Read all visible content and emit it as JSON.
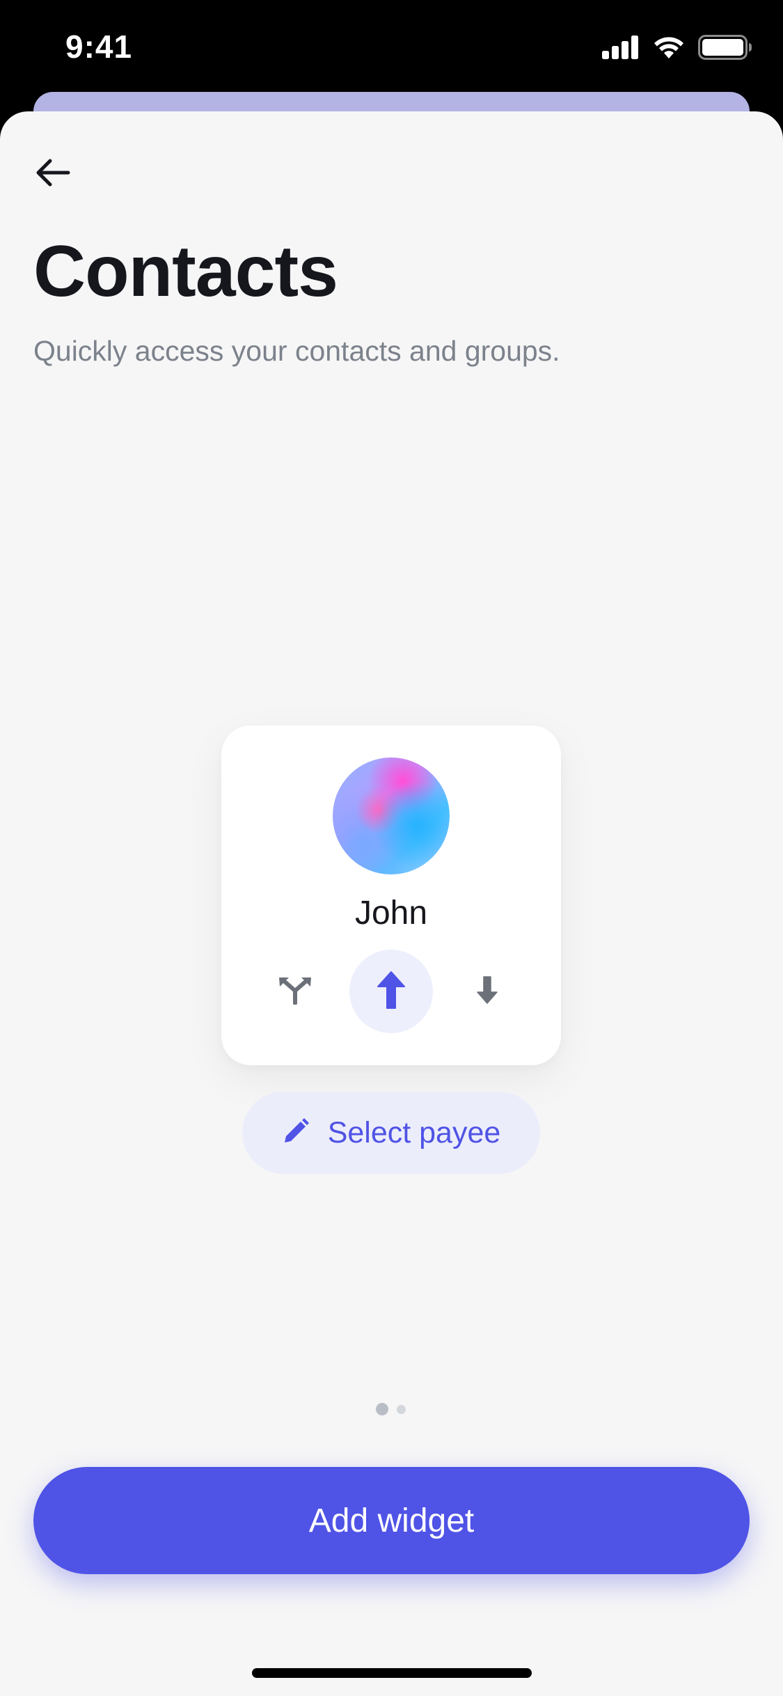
{
  "status_bar": {
    "time": "9:41",
    "icons": [
      "cellular-signal-icon",
      "wifi-icon",
      "battery-icon"
    ]
  },
  "header": {
    "back_icon": "arrow-left-icon",
    "title": "Contacts",
    "subtitle": "Quickly access your contacts and groups."
  },
  "widget": {
    "contact_name": "John",
    "actions": [
      {
        "name": "split",
        "icon": "split-arrows-icon",
        "active": false
      },
      {
        "name": "send",
        "icon": "arrow-up-icon",
        "active": true
      },
      {
        "name": "request",
        "icon": "arrow-down-icon",
        "active": false
      }
    ]
  },
  "select_payee": {
    "icon": "pencil-icon",
    "label": "Select payee"
  },
  "pagination": {
    "current_page": 1,
    "total_pages": 2
  },
  "primary_action": {
    "label": "Add widget"
  },
  "colors": {
    "accent": "#4f53e6",
    "accent_soft": "#ecedfb",
    "background": "#f6f6f7",
    "title": "#15171c",
    "subtitle": "#7c828b",
    "icon_muted": "#6b7079"
  }
}
